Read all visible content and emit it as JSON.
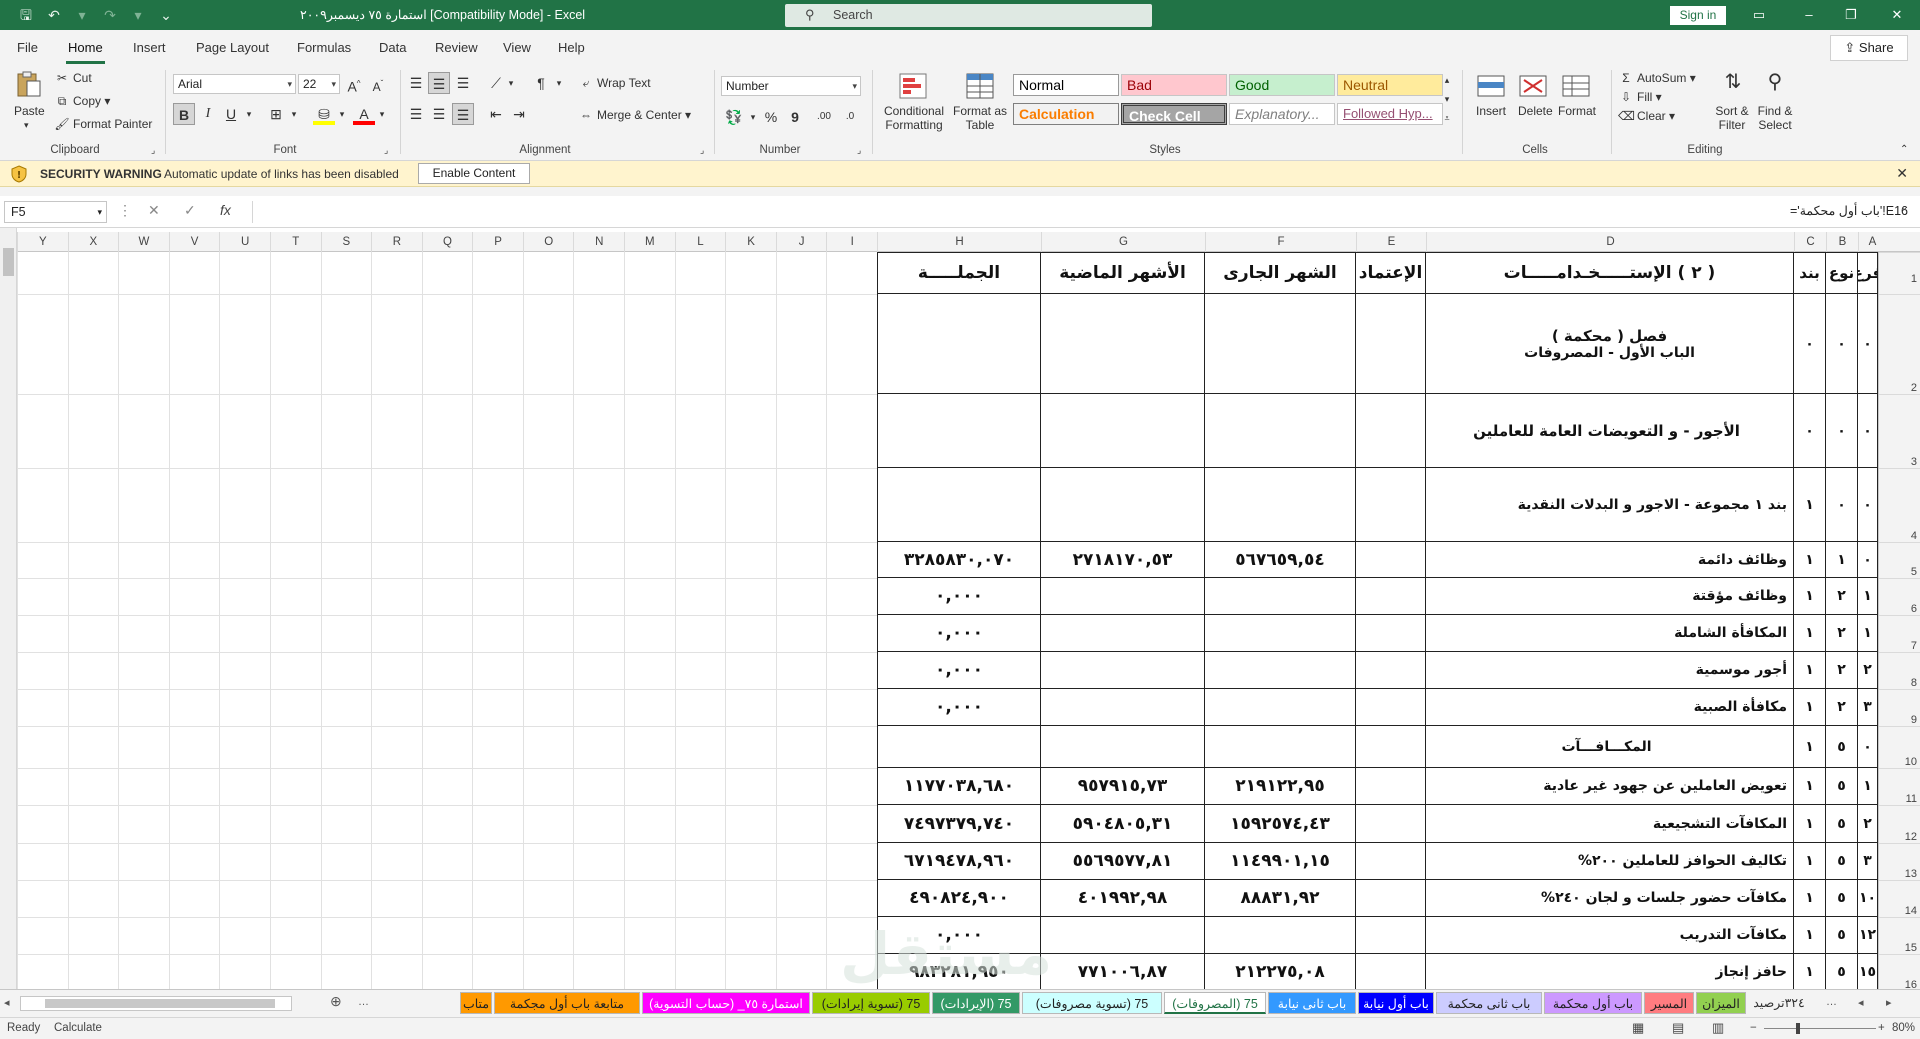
{
  "titlebar": {
    "doc_title": "استمارة ٧٥ ديسمبر٢٠٠٩  [Compatibility Mode]  -  Excel",
    "search_placeholder": "Search",
    "signin": "Sign in"
  },
  "menu": {
    "tabs": [
      "File",
      "Home",
      "Insert",
      "Page Layout",
      "Formulas",
      "Data",
      "Review",
      "View",
      "Help"
    ],
    "active": "Home",
    "share": "Share"
  },
  "ribbon": {
    "clipboard": {
      "paste": "Paste",
      "cut": "Cut",
      "copy": "Copy",
      "format_painter": "Format Painter",
      "label": "Clipboard"
    },
    "font": {
      "name": "Arial",
      "size": "22",
      "label": "Font"
    },
    "alignment": {
      "wrap": "Wrap Text",
      "merge": "Merge & Center",
      "label": "Alignment"
    },
    "number": {
      "format": "Number",
      "label": "Number"
    },
    "styles": {
      "conditional": "Conditional Formatting",
      "format_as_table": "Format as Table",
      "cells": [
        {
          "name": "Normal",
          "bg": "#ffffff",
          "color": "#000000"
        },
        {
          "name": "Bad",
          "bg": "#ffc7ce",
          "color": "#9c0006"
        },
        {
          "name": "Good",
          "bg": "#c6efce",
          "color": "#006100"
        },
        {
          "name": "Neutral",
          "bg": "#ffeb9c",
          "color": "#9c5700"
        },
        {
          "name": "Calculation",
          "bg": "#f2f2f2",
          "color": "#fa7d00"
        },
        {
          "name": "Check Cell",
          "bg": "#a5a5a5",
          "color": "#ffffff"
        },
        {
          "name": "Explanatory...",
          "bg": "#ffffff",
          "color": "#7f7f7f"
        },
        {
          "name": "Followed Hyp...",
          "bg": "#ffffff",
          "color": "#954f72"
        }
      ],
      "label": "Styles"
    },
    "cells": {
      "insert": "Insert",
      "delete": "Delete",
      "format": "Format",
      "label": "Cells"
    },
    "editing": {
      "autosum": "AutoSum",
      "fill": "Fill",
      "clear": "Clear",
      "sort": "Sort & Filter",
      "find": "Find & Select",
      "label": "Editing"
    }
  },
  "security": {
    "title": "SECURITY WARNING",
    "message": "Automatic update of links has been disabled",
    "button": "Enable Content"
  },
  "formula_bar": {
    "name_box": "F5",
    "formula": "='باب أول محكمة'!E16"
  },
  "columns_left": [
    "Y",
    "X",
    "W",
    "V",
    "U",
    "T",
    "S",
    "R",
    "Q",
    "P",
    "O",
    "N",
    "M",
    "L",
    "K",
    "J",
    "I"
  ],
  "columns_table": [
    "H",
    "G",
    "F",
    "E",
    "D",
    "C",
    "B",
    "A"
  ],
  "row_numbers": [
    "1",
    "2",
    "3",
    "4",
    "5",
    "6",
    "7",
    "8",
    "9",
    "10",
    "11",
    "12",
    "13",
    "14",
    "15",
    "16"
  ],
  "sheet": {
    "headers": {
      "far": "فرع",
      "now": "نوع",
      "band": "بند",
      "usage": "( ٢ ) الإستـــــخـدامـــــات",
      "budget": "الإعتماد",
      "current": "الشهر الجارى",
      "past": "الأشهر الماضية",
      "total": "الجملـــــة"
    },
    "rows": [
      {
        "far": "٠",
        "now": "٠",
        "band": "٠",
        "label": "فصل ( محكمة )",
        "label2": "الباب الأول - المصروفات",
        "current": "",
        "past": "",
        "total": ""
      },
      {
        "far": "٠",
        "now": "٠",
        "band": "٠",
        "label": "الأجور - و التعويضات العامة للعاملين",
        "label2": "",
        "current": "",
        "past": "",
        "total": ""
      },
      {
        "far": "٠",
        "now": "٠",
        "band": "١",
        "label": "بند ١ مجموعة - الاجور و البدلات النقدية",
        "label2": "",
        "current": "",
        "past": "",
        "total": ""
      },
      {
        "far": "٠",
        "now": "١",
        "band": "١",
        "label": "وظائف دائمة",
        "label2": "",
        "current": "٥٦٧٦٥٩,٥٤",
        "past": "٢٧١٨١٧٠,٥٣",
        "total": "٣٢٨٥٨٣٠,٠٧٠"
      },
      {
        "far": "١",
        "now": "٢",
        "band": "١",
        "label": "وظائف مؤقتة",
        "label2": "",
        "current": "",
        "past": "",
        "total": "٠,٠٠٠"
      },
      {
        "far": "١",
        "now": "٢",
        "band": "١",
        "label": "المكافأة الشاملة",
        "label2": "",
        "current": "",
        "past": "",
        "total": "٠,٠٠٠"
      },
      {
        "far": "٢",
        "now": "٢",
        "band": "١",
        "label": "أجور موسمية",
        "label2": "",
        "current": "",
        "past": "",
        "total": "٠,٠٠٠"
      },
      {
        "far": "٣",
        "now": "٢",
        "band": "١",
        "label": "مكافأة الصبية",
        "label2": "",
        "current": "",
        "past": "",
        "total": "٠,٠٠٠"
      },
      {
        "far": "٠",
        "now": "٥",
        "band": "١",
        "label": "المكـــافـــآت",
        "label2": "",
        "current": "",
        "past": "",
        "total": ""
      },
      {
        "far": "١",
        "now": "٥",
        "band": "١",
        "label": "تعويض العاملين عن جهود غير عادية",
        "label2": "",
        "current": "٢١٩١٢٢,٩٥",
        "past": "٩٥٧٩١٥,٧٣",
        "total": "١١٧٧٠٣٨,٦٨٠"
      },
      {
        "far": "٢",
        "now": "٥",
        "band": "١",
        "label": "المكافآت التشجيعية",
        "label2": "",
        "current": "١٥٩٢٥٧٤,٤٣",
        "past": "٥٩٠٤٨٠٥,٣١",
        "total": "٧٤٩٧٣٧٩,٧٤٠"
      },
      {
        "far": "٣",
        "now": "٥",
        "band": "١",
        "label": "تكاليف الحوافز للعاملين ٢٠٠%",
        "label2": "",
        "current": "١١٤٩٩٠١,١٥",
        "past": "٥٥٦٩٥٧٧,٨١",
        "total": "٦٧١٩٤٧٨,٩٦٠"
      },
      {
        "far": "١٠",
        "now": "٥",
        "band": "١",
        "label": "مكافآت حضور جلسات و لجان ٢٤٠%",
        "label2": "",
        "current": "٨٨٨٣١,٩٢",
        "past": "٤٠١٩٩٢,٩٨",
        "total": "٤٩٠٨٢٤,٩٠٠"
      },
      {
        "far": "١٢",
        "now": "٥",
        "band": "١",
        "label": "مكافآت التدريب",
        "label2": "",
        "current": "",
        "past": "",
        "total": "٠,٠٠٠"
      },
      {
        "far": "١٥",
        "now": "٥",
        "band": "١",
        "label": "حافز إنجاز",
        "label2": "",
        "current": "٢١٢٢٧٥,٠٨",
        "past": "٧٧١٠٠٦,٨٧",
        "total": "٩٨٣٢٨١,٩٥٠"
      }
    ]
  },
  "sheet_tabs": [
    {
      "name": "٣٢٤ترصيد",
      "bg": "#f3f3f3",
      "color": "#333"
    },
    {
      "name": "الميزان",
      "bg": "#92d050",
      "color": "#222"
    },
    {
      "name": "المسير",
      "bg": "#ff7c80",
      "color": "#222"
    },
    {
      "name": "باب أول محكمة",
      "bg": "#cc99ff",
      "color": "#222"
    },
    {
      "name": "باب ثانى محكمة",
      "bg": "#ccccff",
      "color": "#222"
    },
    {
      "name": "باب أول نيابة",
      "bg": "#0000ff",
      "color": "#ffffff"
    },
    {
      "name": "باب ثانى نيابة",
      "bg": "#3399ff",
      "color": "#ffffff"
    },
    {
      "name": "(المصروفات) 75",
      "bg": "#ffffff",
      "color": "#217346",
      "active": true
    },
    {
      "name": "(تسوية مصروفات) 75",
      "bg": "#ccffff",
      "color": "#222"
    },
    {
      "name": "(الإيرادات) 75",
      "bg": "#339966",
      "color": "#ffffff"
    },
    {
      "name": "(تسوية إيرادات) 75",
      "bg": "#99cc00",
      "color": "#222"
    },
    {
      "name": "استمارة ٧٥_ (حساب التسوية)",
      "bg": "#ff00ff",
      "color": "#ffffff"
    },
    {
      "name": "متابعة باب أول مجكمة",
      "bg": "#ff9900",
      "color": "#222"
    },
    {
      "name": "متاب",
      "bg": "#ff9900",
      "color": "#222"
    }
  ],
  "status": {
    "ready": "Ready",
    "calculate": "Calculate",
    "zoom": "80%"
  },
  "watermark": "مستقل"
}
